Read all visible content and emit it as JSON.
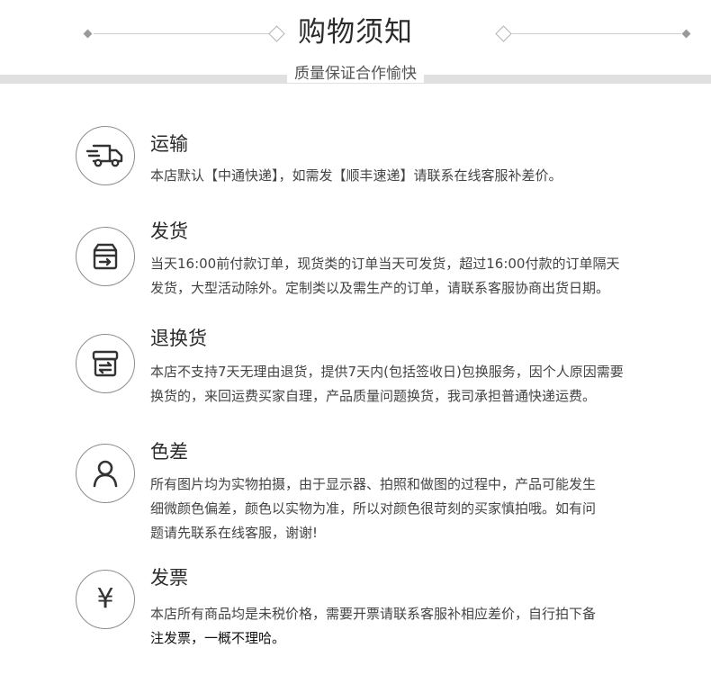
{
  "header": {
    "title": "购物须知",
    "subtitle": "质量保证合作愉快"
  },
  "items": [
    {
      "icon": "truck-icon",
      "title": "运输",
      "lines": [
        "本店默认【中通快递】，如需发【顺丰速递】请联系在线客服补差价。"
      ]
    },
    {
      "icon": "shipment-box-icon",
      "title": "发货",
      "lines": [
        "当天16:00前付款订单，现货类的订单当天可发货，超过16:00付款的订单隔天",
        "发货，大型活动除外。定制类以及需生产的订单，请联系客服协商出货日期。"
      ]
    },
    {
      "icon": "return-box-icon",
      "title": "退换货",
      "lines": [
        "本店不支持7天无理由退货，提供7天内(包括签收日)包换服务，因个人原因需要",
        "换货的，来回运费买家自理，产品质量问题换货，我司承担普通快递运费。"
      ]
    },
    {
      "icon": "person-icon",
      "title": "色差",
      "lines": [
        "所有图片均为实物拍摄，由于显示器、拍照和做图的过程中，产品可能发生",
        "细微颜色偏差，颜色以实物为准，所以对颜色很苛刻的买家慎拍哦。如有问",
        "题请先联系在线客服，谢谢!"
      ]
    },
    {
      "icon": "yen-icon",
      "title": "发票",
      "lines": [
        "本店所有商品均是未税价格，需要开票请联系客服补相应差价，自行拍下备",
        "注发票，一概不理哈。"
      ]
    }
  ],
  "colors": {
    "icon_stroke": "#333333",
    "circle_border": "#8c8c8c",
    "band": "#e0e0e0"
  }
}
